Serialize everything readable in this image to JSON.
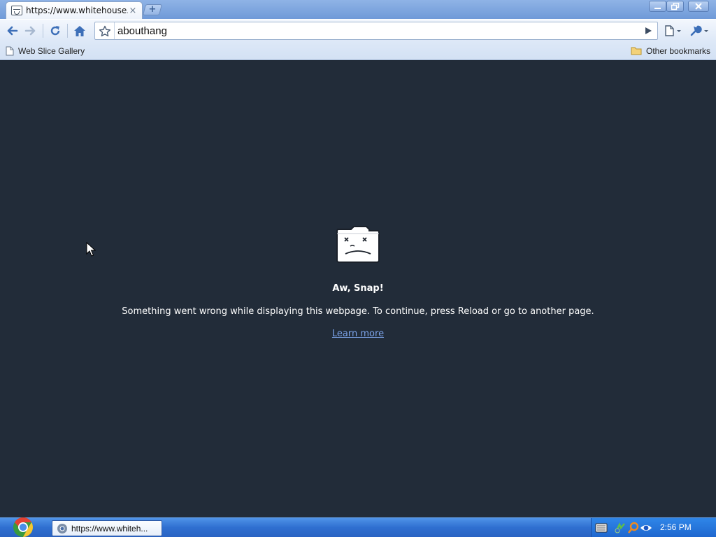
{
  "browser": {
    "tab": {
      "title": "https://www.whitehouse....",
      "close_glyph": "×"
    },
    "new_tab_glyph": "+",
    "window_controls": {
      "minimize_icon": "minimize-icon",
      "maximize_icon": "restore-icon",
      "close_icon": "close-icon"
    },
    "toolbar": {
      "back_icon": "arrow-left-icon",
      "forward_icon": "arrow-right-icon",
      "reload_icon": "reload-icon",
      "home_icon": "home-icon",
      "star_icon": "star-icon",
      "go_icon": "play-icon",
      "page_menu_icon": "page-icon",
      "wrench_menu_icon": "wrench-icon"
    },
    "omnibox": {
      "value": "abouthang"
    },
    "bookmarks": {
      "left_item": "Web Slice Gallery",
      "right_item": "Other bookmarks"
    }
  },
  "content": {
    "heading": "Aw, Snap!",
    "message": "Something went wrong while displaying this webpage. To continue, press Reload or go to another page.",
    "link": "Learn more",
    "colors": {
      "background": "#222c39",
      "link": "#7ba2e8"
    }
  },
  "taskbar": {
    "start_icon": "chrome-logo-icon",
    "task_button_label": "https://www.whiteh...",
    "clock": "2:56 PM"
  }
}
